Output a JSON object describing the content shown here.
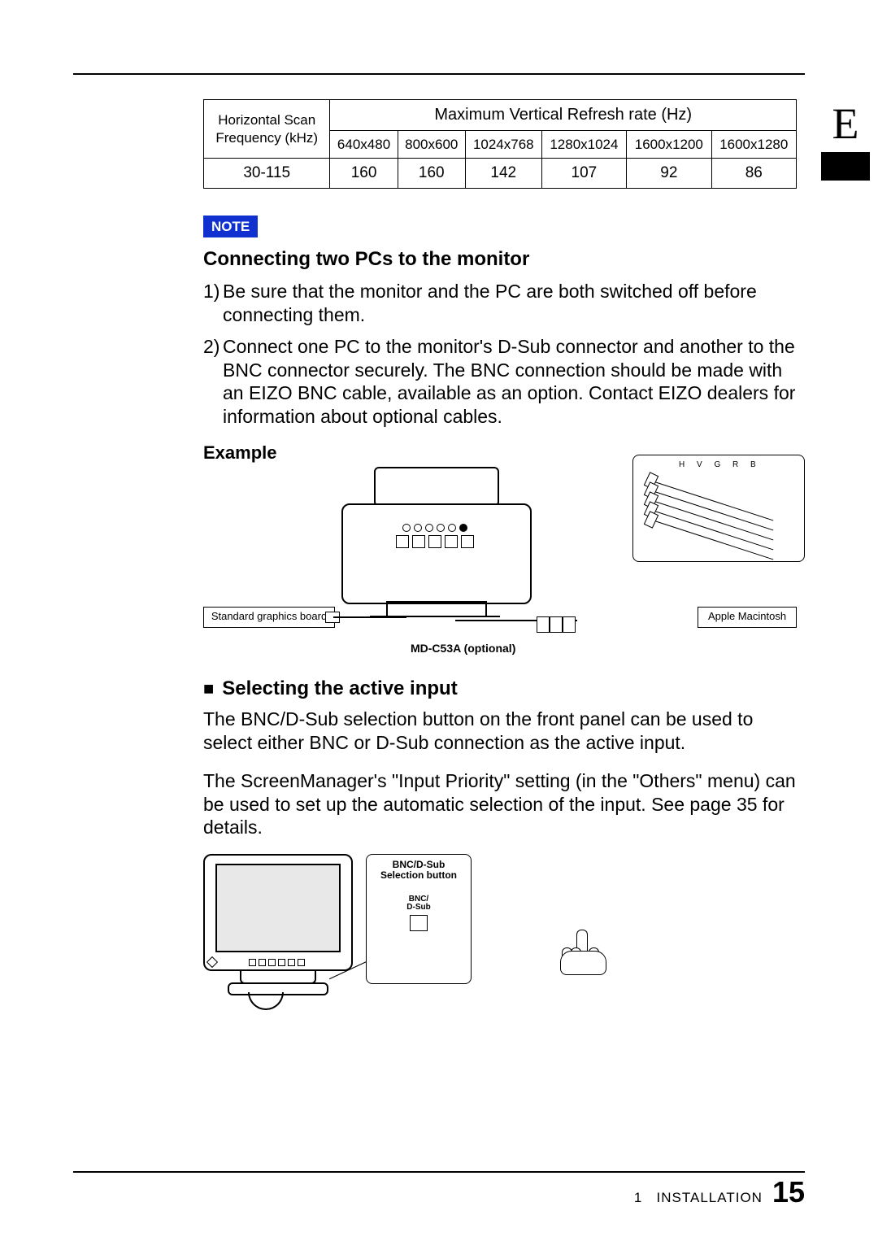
{
  "side_tab": "E",
  "table": {
    "row_header_l1": "Horizontal Scan",
    "row_header_l2": "Frequency (kHz)",
    "group_header": "Maximum Vertical Refresh rate (Hz)",
    "cols": [
      "640x480",
      "800x600",
      "1024x768",
      "1280x1024",
      "1600x1200",
      "1600x1280"
    ],
    "freq": "30-115",
    "vals": [
      "160",
      "160",
      "142",
      "107",
      "92",
      "86"
    ]
  },
  "note_label": "NOTE",
  "h_connect": "Connecting two PCs to the monitor",
  "li1_num": "1)",
  "li1_txt": "Be sure that the monitor and the PC are both switched off before connecting them.",
  "li2_num": "2)",
  "li2_txt": "Connect one PC to the monitor's D-Sub connector and another to the BNC connector securely.  The BNC connection should be made with an EIZO BNC cable, available as an option.  Contact EIZO dealers for information about optional cables.",
  "example_label": "Example",
  "diagram1": {
    "std_board": "Standard graphics board",
    "md_label": "MD-C53A (optional)",
    "apple": "Apple Macintosh",
    "bnc_letters": "H V G R B"
  },
  "h_select": "Selecting the active input",
  "p_select1": "The BNC/D-Sub selection button on the front panel can be used to select either BNC or D-Sub connection as the active input.",
  "p_select2": "The ScreenManager's \"Input Priority\" setting (in the \"Others\" menu) can be used to set up the automatic selection of the input. See page 35 for details.",
  "diagram2": {
    "title_l1": "BNC/D-Sub",
    "title_l2": "Selection button",
    "btn_l1": "BNC/",
    "btn_l2": "D-Sub"
  },
  "footer": {
    "chapter_num": "1",
    "chapter_title": "INSTALLATION",
    "page": "15"
  }
}
